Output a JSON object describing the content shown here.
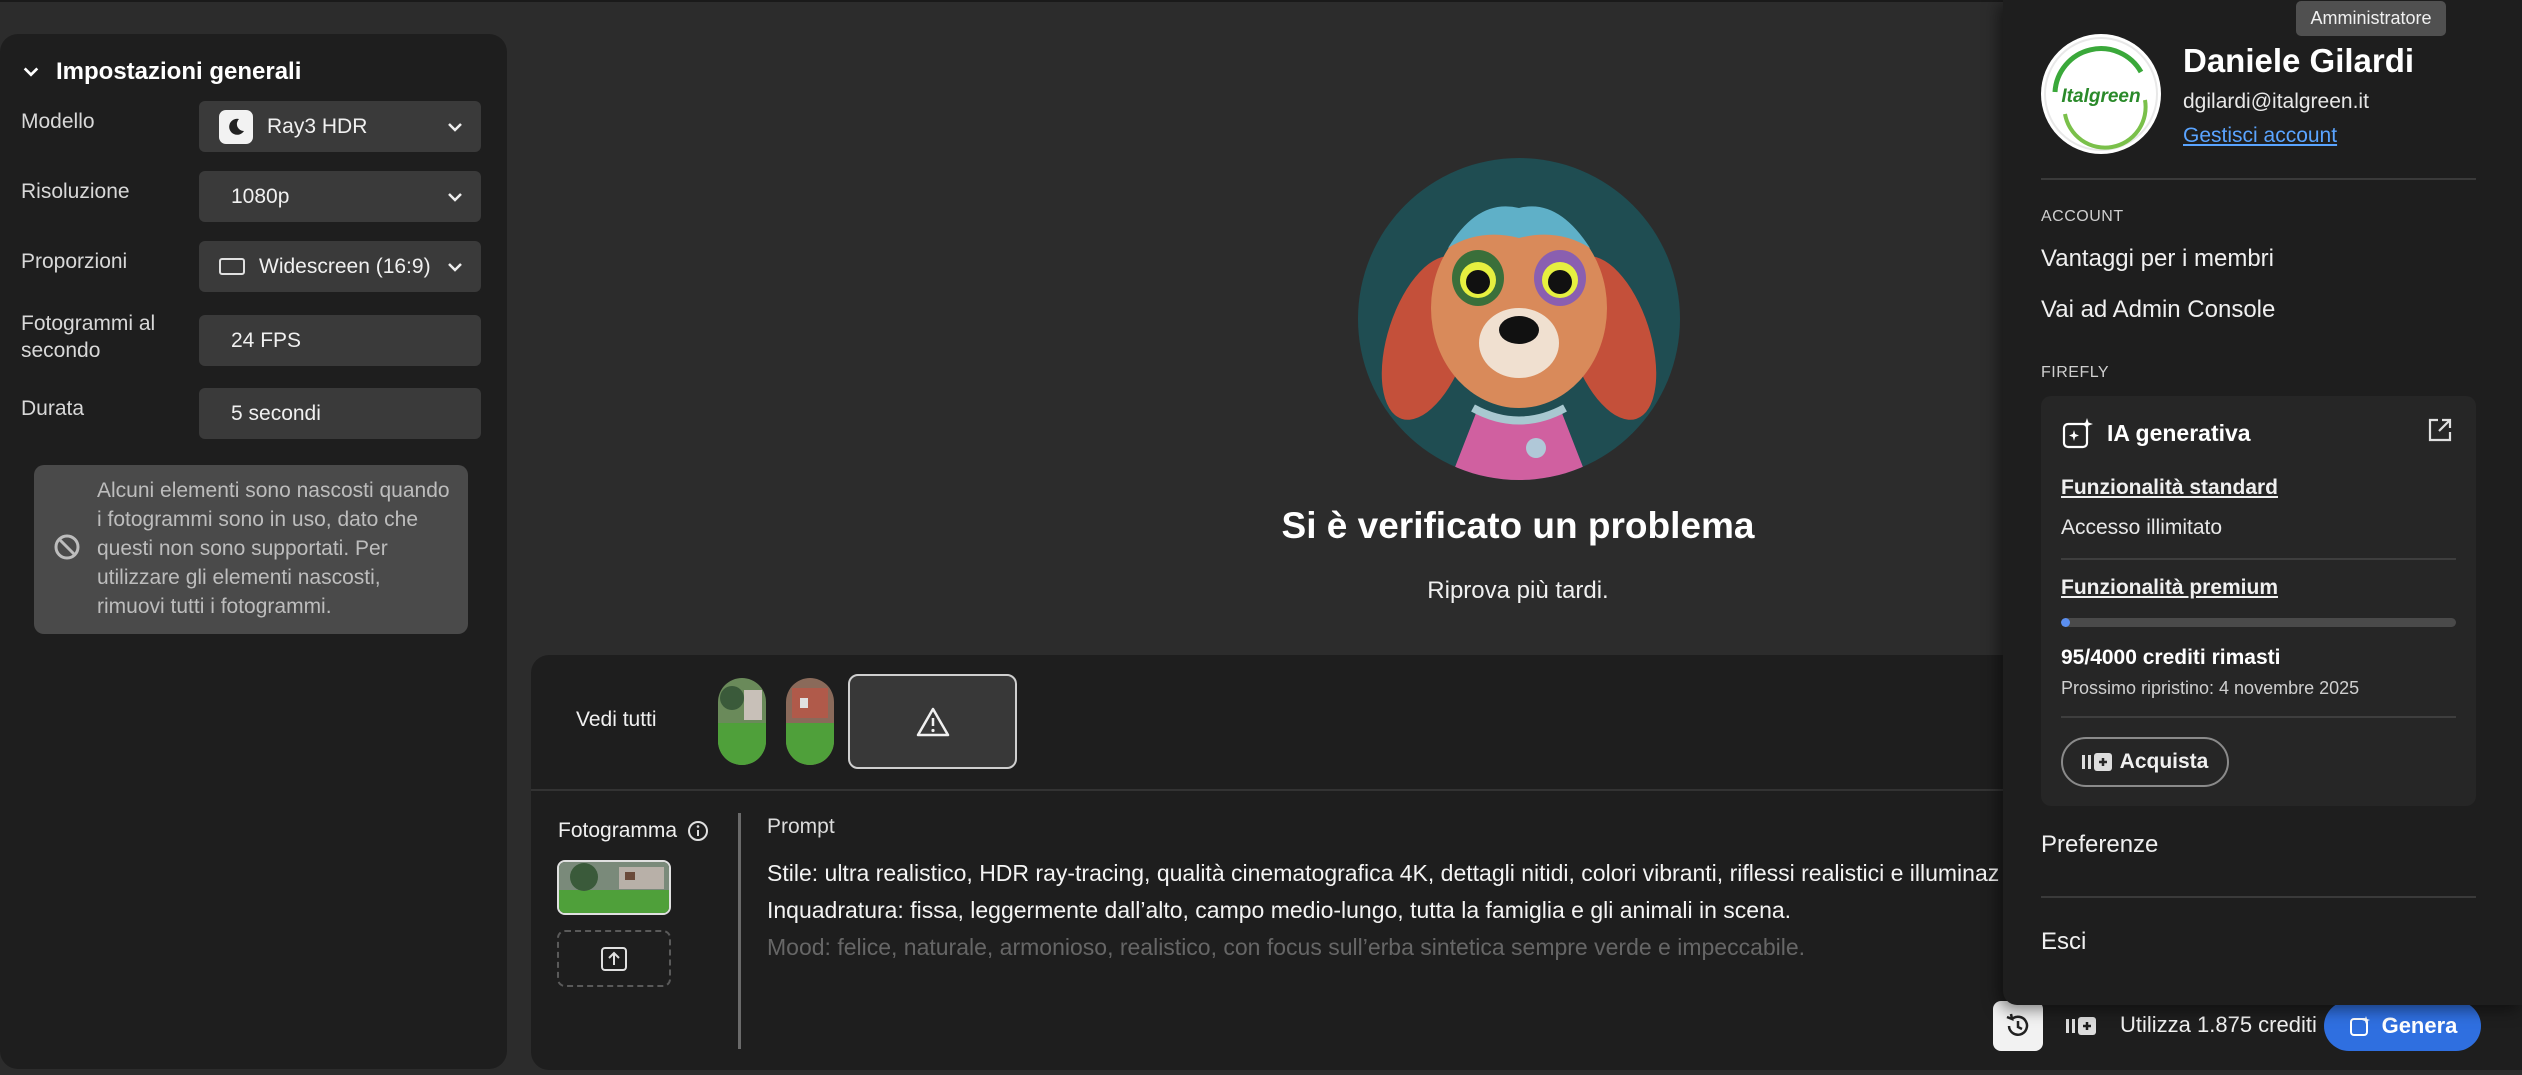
{
  "settings": {
    "title": "Impostazioni generali",
    "model": {
      "label": "Modello",
      "value": "Ray3 HDR"
    },
    "resolution": {
      "label": "Risoluzione",
      "value": "1080p"
    },
    "ratio": {
      "label": "Proporzioni",
      "value": "Widescreen (16:9)"
    },
    "fps": {
      "label_line1": "Fotogrammi al",
      "label_line2": "secondo",
      "value": "24 FPS"
    },
    "duration": {
      "label": "Durata",
      "value": "5 secondi"
    },
    "notice": "Alcuni elementi sono nascosti quando i fotogrammi sono in uso, dato che questi non sono supportati. Per utilizzare gli elementi nascosti, rimuovi tutti i fotogrammi."
  },
  "preview": {
    "error_title": "Si è verificato un problema",
    "error_sub": "Riprova più tardi."
  },
  "history": {
    "see_all": "Vedi tutti"
  },
  "prompt": {
    "frame_label": "Fotogramma",
    "label": "Prompt",
    "line1": "Stile: ultra realistico, HDR ray-tracing, qualità cinematografica 4K, dettagli nitidi, colori vibranti, riflessi realistici e illuminaz",
    "line2": "Inquadratura: fissa, leggermente dall’alto, campo medio-lungo, tutta la famiglia e gli animali in scena.",
    "line3": "Mood: felice, naturale, armonioso, realistico, con focus sull’erba sintetica sempre verde e impeccabile."
  },
  "toolbar": {
    "credits": "Utilizza 1.875 crediti",
    "generate": "Genera"
  },
  "account": {
    "role_badge": "Amministratore",
    "logo_text": "Italgreen",
    "name": "Daniele Gilardi",
    "email": "dgilardi@italgreen.it",
    "manage": "Gestisci account",
    "section_account": "ACCOUNT",
    "member_benefits": "Vantaggi per i membri",
    "admin_console": "Vai ad Admin Console",
    "section_firefly": "FIREFLY",
    "ia_title": "IA generativa",
    "standard_link": "Funzionalità standard",
    "standard_value": "Accesso illimitato",
    "premium_link": "Funzionalità premium",
    "credits_used_fraction": 0.024,
    "credits_left": "95/4000 crediti rimasti",
    "next_reset": "Prossimo ripristino: 4 novembre 2025",
    "buy": "Acquista",
    "preferences": "Preferenze",
    "sign_out": "Esci"
  },
  "colors": {
    "accent": "#2f6fe0",
    "link": "#5aa4ff",
    "progress": "#5b8ff0"
  }
}
